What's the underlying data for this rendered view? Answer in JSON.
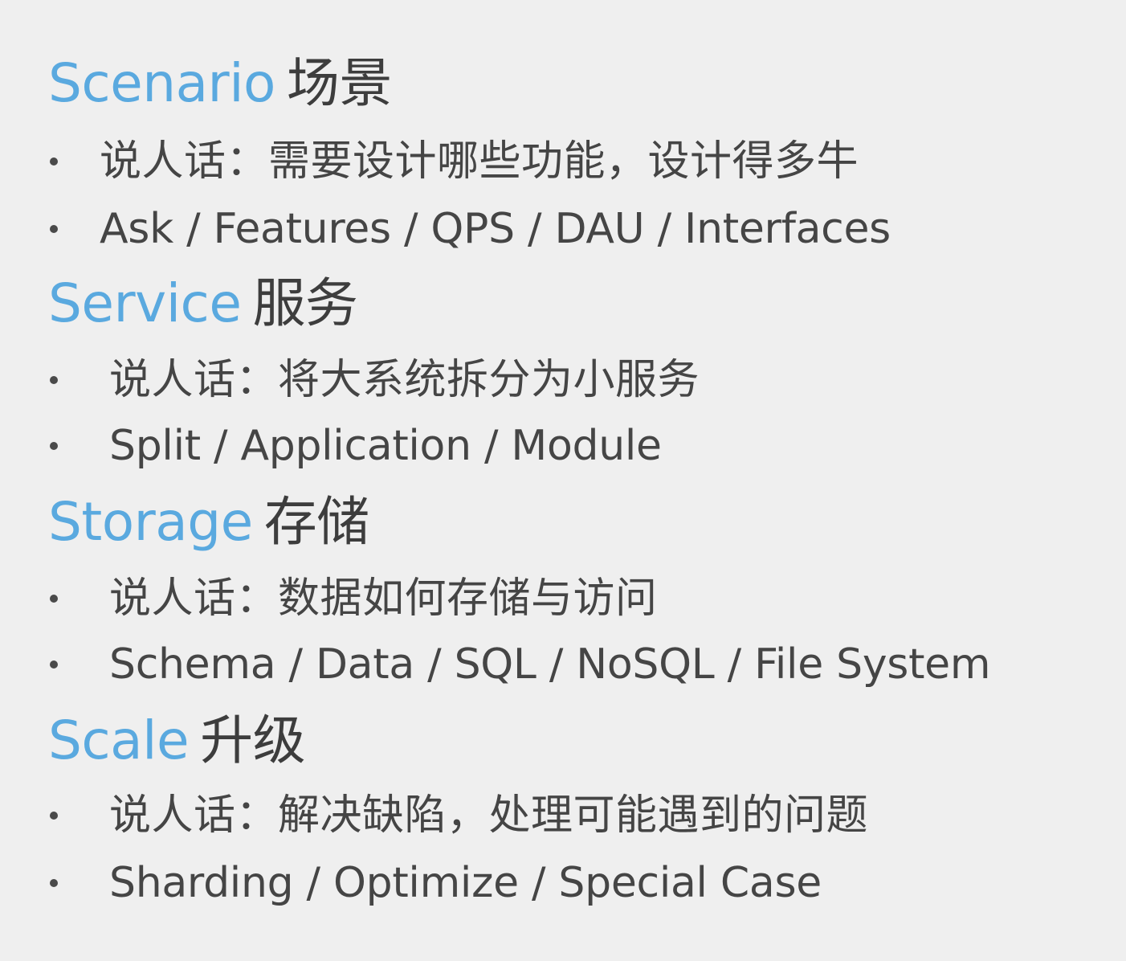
{
  "sections": [
    {
      "title_en": "Scenario",
      "title_zh": "场景",
      "bullets": [
        "说人话：需要设计哪些功能，设计得多牛",
        "Ask / Features / QPS / DAU / Interfaces"
      ]
    },
    {
      "title_en": "Service",
      "title_zh": "服务",
      "bullets": [
        "说人话：将大系统拆分为小服务",
        "Split / Application / Module"
      ]
    },
    {
      "title_en": "Storage",
      "title_zh": "存储",
      "bullets": [
        "说人话：数据如何存储与访问",
        "Schema / Data / SQL / NoSQL / File System"
      ]
    },
    {
      "title_en": "Scale",
      "title_zh": "升级",
      "bullets": [
        "说人话：解决缺陷，处理可能遇到的问题",
        "Sharding / Optimize / Special Case"
      ]
    }
  ],
  "colors": {
    "background": "#efefef",
    "title_accent": "#5aa9df",
    "text": "#454545"
  }
}
